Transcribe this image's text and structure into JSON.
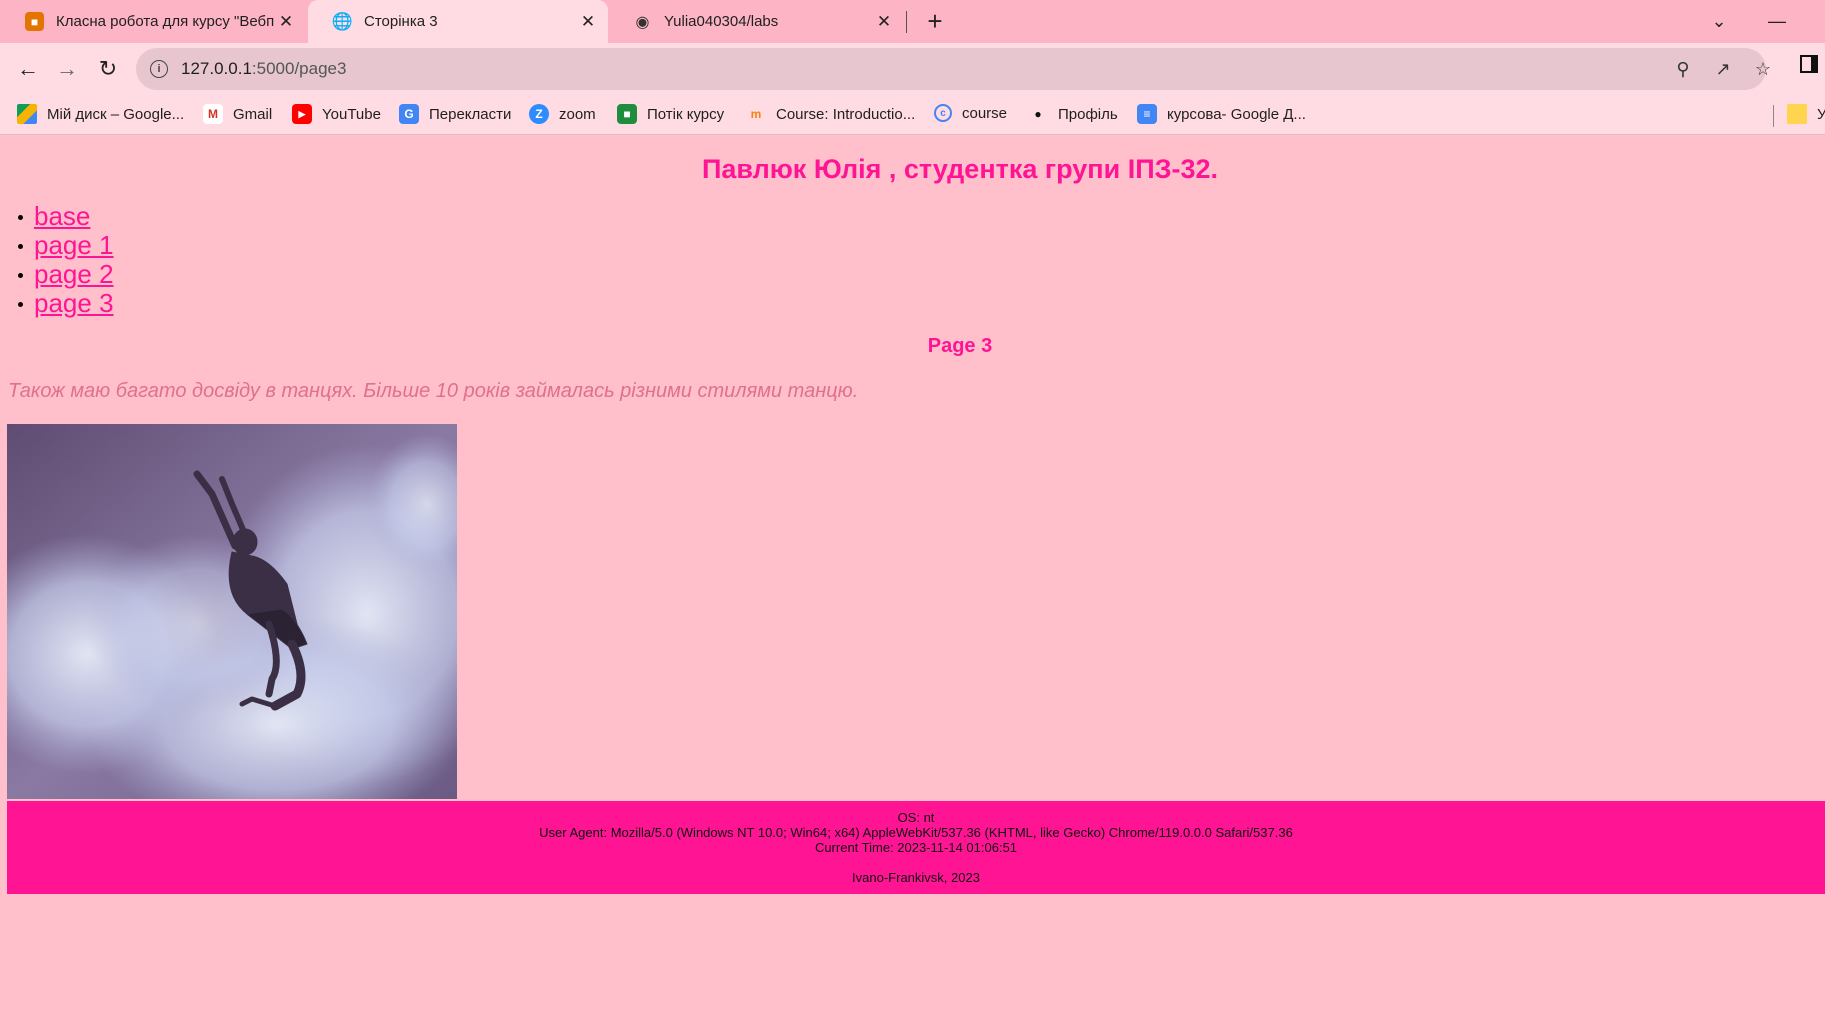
{
  "browser": {
    "tabs": [
      {
        "title": "Класна робота для курсу \"Вебп",
        "active": false
      },
      {
        "title": "Сторінка 3",
        "active": true
      },
      {
        "title": "Yulia040304/labs",
        "active": false
      }
    ],
    "url_host": "127.0.0.1",
    "url_path": ":5000/page3",
    "bookmarks": [
      {
        "label": "Мій диск – Google...",
        "icon": "google-drive-icon"
      },
      {
        "label": "Gmail",
        "icon": "gmail-icon"
      },
      {
        "label": "YouTube",
        "icon": "youtube-icon"
      },
      {
        "label": "Перекласти",
        "icon": "translate-icon"
      },
      {
        "label": "zoom",
        "icon": "zoom-icon"
      },
      {
        "label": "Потік курсу",
        "icon": "classroom-icon"
      },
      {
        "label": "Course: Introductio...",
        "icon": "moodle-icon"
      },
      {
        "label": "course",
        "icon": "course-icon"
      },
      {
        "label": "Профіль",
        "icon": "profile-icon"
      },
      {
        "label": "курсова- Google Д...",
        "icon": "google-docs-icon"
      },
      {
        "label": "У",
        "icon": "folder-icon"
      }
    ]
  },
  "page": {
    "title": "Павлюк Юлія , студентка групи ІПЗ-32.",
    "nav": [
      "base",
      "page 1",
      "page 2",
      "page 3"
    ],
    "heading": "Page 3",
    "intro": "Також маю багато досвіду в танцях. Більше 10 років займалась різними стилями танцю.",
    "footer": {
      "os": "OS: nt",
      "user_agent": "User Agent: Mozilla/5.0 (Windows NT 10.0; Win64; x64) AppleWebKit/537.36 (KHTML, like Gecko) Chrome/119.0.0.0 Safari/537.36",
      "time": "Current Time: 2023-11-14 01:06:51",
      "city": "Ivano-Frankivsk, 2023"
    }
  },
  "colors": {
    "page_bg": "#ffc0cb",
    "accent": "#ff1493",
    "tabstrip": "#fdb4c4",
    "toolbar": "#ffdbe3"
  }
}
